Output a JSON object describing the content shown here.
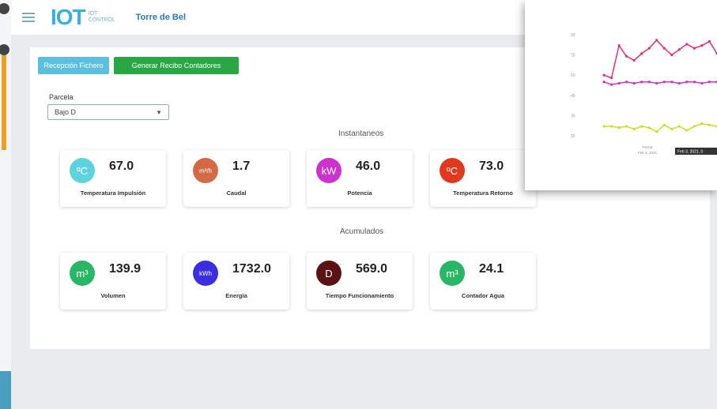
{
  "header": {
    "title": "Torre de Bel"
  },
  "logo": {
    "text": "IOT",
    "subtitle": "IOT CONTROL"
  },
  "actions": {
    "primary_label": "Recepción Fichero",
    "secondary_label": "Generar Recibo Contadores"
  },
  "selector": {
    "label": "Parcela",
    "value": "Bajo D"
  },
  "instantaneos": {
    "title": "Instantaneos",
    "cards": [
      {
        "unit": "ºC",
        "value": "67.0",
        "label": "Temperatura Impulsión",
        "color": "#5fd3dd"
      },
      {
        "unit": "m³/h",
        "value": "1.7",
        "label": "Caudal",
        "color": "#d46a45"
      },
      {
        "unit": "kW",
        "value": "46.0",
        "label": "Potencia",
        "color": "#cc33cc"
      },
      {
        "unit": "ºC",
        "value": "73.0",
        "label": "Temperatura Retorno",
        "color": "#e03a1e"
      }
    ]
  },
  "acumulados": {
    "title": "Acumulados",
    "cards": [
      {
        "unit": "m³",
        "value": "139.9",
        "label": "Volumen",
        "color": "#29b765"
      },
      {
        "unit": "kWh",
        "value": "1732.0",
        "label": "Energía",
        "color": "#3a2fe0"
      },
      {
        "unit": "D",
        "value": "569.0",
        "label": "Tiempo Funcionamiento",
        "color": "#5a1212"
      },
      {
        "unit": "m³",
        "value": "24.1",
        "label": "Contador Agua",
        "color": "#29b765"
      }
    ]
  },
  "chart_data": {
    "type": "line",
    "y_ticks": [
      "90",
      "75",
      "60",
      "45",
      "30",
      "15"
    ],
    "series": [
      {
        "color": "#e0307a",
        "values": [
          60,
          58,
          82,
          74,
          71,
          76,
          80,
          86,
          80,
          75,
          79,
          83,
          80,
          82,
          85,
          76
        ]
      },
      {
        "color": "#cc33cc",
        "values": [
          55,
          53,
          54,
          55,
          54,
          55,
          55,
          54,
          55,
          55,
          54,
          55,
          55,
          54,
          55,
          55
        ]
      },
      {
        "color": "#c8e020",
        "values": [
          22,
          22,
          21,
          22,
          20,
          22,
          21,
          18,
          23,
          20,
          22,
          19,
          22,
          24,
          23,
          22
        ]
      }
    ],
    "x_label": "Fecha\nFeb 3, 2021",
    "tooltip": "Feb 3, 2021, 0"
  }
}
